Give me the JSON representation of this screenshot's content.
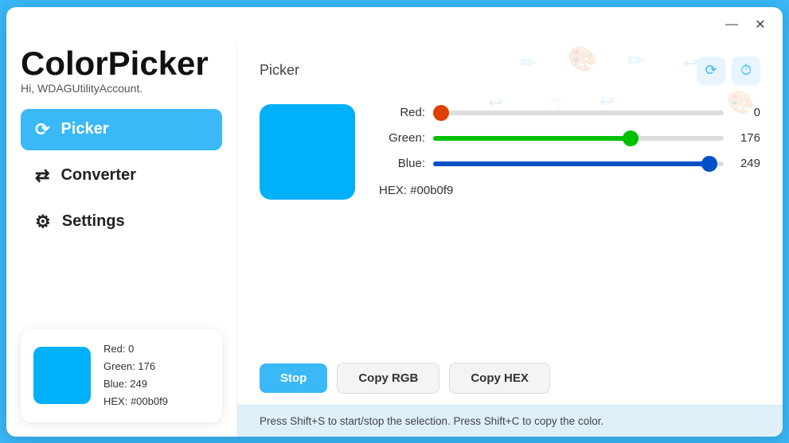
{
  "app": {
    "title": "ColorPicker",
    "greeting": "Hi, WDAGUtilityAccount."
  },
  "titlebar": {
    "minimize_label": "—",
    "close_label": "✕"
  },
  "nav": {
    "items": [
      {
        "id": "picker",
        "label": "Picker",
        "icon": "↻",
        "active": true
      },
      {
        "id": "converter",
        "label": "Converter",
        "icon": "⇄",
        "active": false
      },
      {
        "id": "settings",
        "label": "Settings",
        "icon": "⚙",
        "active": false
      }
    ]
  },
  "color_card": {
    "red_label": "Red: 0",
    "green_label": "Green: 176",
    "blue_label": "Blue: 249",
    "hex_label": "HEX: #00b0f9",
    "swatch_color": "#00b0f9"
  },
  "picker": {
    "section_title": "Picker",
    "swatch_color": "#00b0f9",
    "red": 0,
    "green": 176,
    "blue": 249,
    "hex": "#00b0f9",
    "hex_label": "HEX: #00b0f9",
    "red_label": "Red:",
    "green_label": "Green:",
    "blue_label": "Blue:"
  },
  "buttons": {
    "stop": "Stop",
    "copy_rgb": "Copy RGB",
    "copy_hex": "Copy HEX"
  },
  "status": {
    "message": "Press Shift+S to start/stop the selection. Press Shift+C to copy the color."
  },
  "deco": {
    "icons": [
      "✏️",
      "🎨",
      "✏️",
      "↩️",
      "♥",
      "↩️",
      "🎨"
    ]
  }
}
